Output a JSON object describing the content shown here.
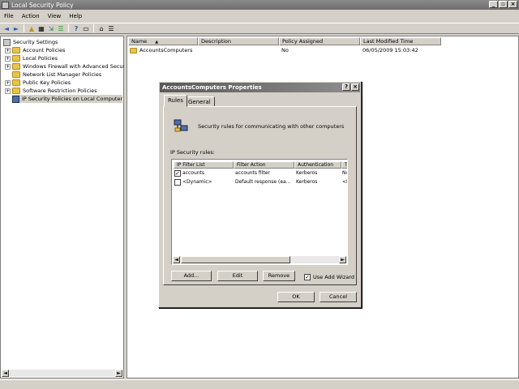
{
  "window": {
    "title": "Local Security Policy",
    "min_label": "_",
    "max_label": "▫",
    "close_label": "×"
  },
  "menu": [
    "File",
    "Action",
    "View",
    "Help"
  ],
  "toolbar": {
    "back": "◄",
    "forward": "►",
    "up": "▲",
    "show_hide": "▦",
    "export": "⇲",
    "help": "?",
    "properties": "▭",
    "policy": "⌂",
    "list": "☰"
  },
  "tree": {
    "root": "Security Settings",
    "items": [
      {
        "label": "Account Policies",
        "expander": "+"
      },
      {
        "label": "Local Policies",
        "expander": "+"
      },
      {
        "label": "Windows Firewall with Advanced Security",
        "expander": "+"
      },
      {
        "label": "Network List Manager Policies",
        "expander": ""
      },
      {
        "label": "Public Key Policies",
        "expander": "+"
      },
      {
        "label": "Software Restriction Policies",
        "expander": "+"
      },
      {
        "label": "IP Security Policies on Local Computer",
        "expander": ""
      }
    ]
  },
  "list": {
    "columns": [
      "Name",
      "Description",
      "Policy Assigned",
      "Last Modified Time"
    ],
    "sort_arrow": "▲",
    "rows": [
      {
        "name": "AccountsComputers",
        "description": "",
        "assigned": "No",
        "modified": "06/05/2009 15:03:42"
      }
    ]
  },
  "scroll": {
    "left": "◄",
    "right": "►"
  },
  "dialog": {
    "title": "AccountsComputers Properties",
    "help_btn": "?",
    "close_btn": "×",
    "tabs": [
      "Rules",
      "General"
    ],
    "description": "Security rules for communicating with other computers",
    "rules_label": "IP Security rules:",
    "columns": [
      "IP Filter List",
      "Filter Action",
      "Authentication",
      "Tu"
    ],
    "rules": [
      {
        "checked": "✓",
        "filter": "accounts",
        "action": "accounts filter",
        "auth": "Kerberos",
        "tunnel": "No"
      },
      {
        "checked": "",
        "filter": "<Dynamic>",
        "action": "Default response (ea...",
        "auth": "Kerberos",
        "tunnel": "<N"
      }
    ],
    "buttons": {
      "add": "Add...",
      "edit": "Edit",
      "remove": "Remove",
      "ok": "OK",
      "cancel": "Cancel"
    },
    "wizard": {
      "label": "Use Add Wizard",
      "checked": "✓"
    }
  },
  "colors": {
    "title_bar": "#7a7a7a",
    "dialog_title": "#5a5a5a",
    "folder": "#e8c44a",
    "chrome": "#d4d0c8"
  }
}
